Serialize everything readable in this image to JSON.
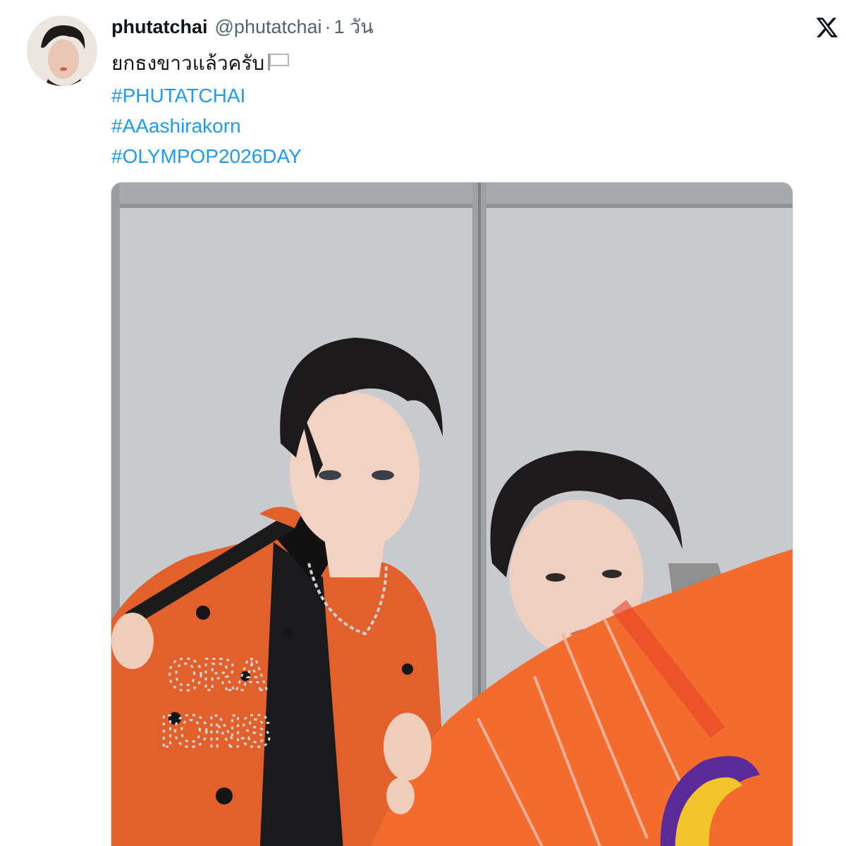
{
  "tweet": {
    "display_name": "phutatchai",
    "handle": "@phutatchai",
    "separator": "·",
    "time": "1 วัน",
    "text": "ยกธงขาวแล้วครับ",
    "flag_emoji": "white-flag",
    "hashtags": [
      "#PHUTATCHAI",
      "#AAashirakorn",
      "#OLYMPOP2026DAY"
    ]
  },
  "icons": {
    "platform_logo": "x-logo-icon",
    "link_color": "#1d9bf0"
  },
  "media": {
    "jacket_text_1": "ORA",
    "jacket_text_2": "IONS"
  }
}
